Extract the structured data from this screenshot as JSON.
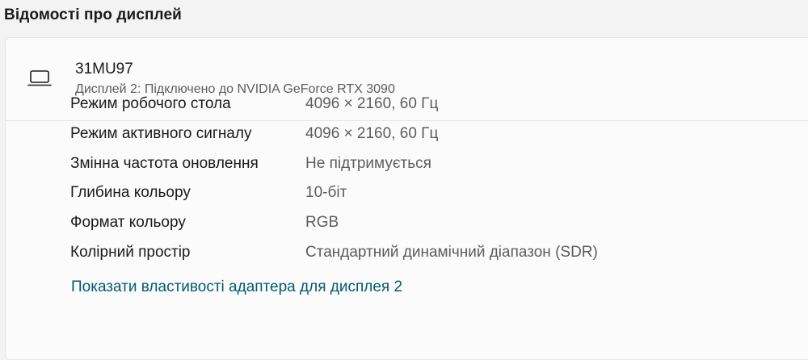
{
  "page": {
    "title": "Відомості про дисплей"
  },
  "display": {
    "name": "31MU97",
    "subtitle": "Дисплей 2: Підключено до NVIDIA GeForce RTX 3090",
    "icon": "laptop-icon"
  },
  "properties": [
    {
      "label": "Режим робочого стола",
      "value": "4096 × 2160, 60 Гц"
    },
    {
      "label": "Режим активного сигналу",
      "value": "4096 × 2160, 60 Гц"
    },
    {
      "label": "Змінна частота оновлення",
      "value": "Не підтримується"
    },
    {
      "label": "Глибина кольору",
      "value": "10-біт"
    },
    {
      "label": "Формат кольору",
      "value": "RGB"
    },
    {
      "label": "Колірний простір",
      "value": "Стандартний динамічний діапазон (SDR)"
    }
  ],
  "link": {
    "adapter_properties": "Показати властивості адаптера для дисплея 2"
  },
  "colors": {
    "link": "#005a70",
    "secondary_text": "#5d5d5d",
    "background": "#f3f3f3",
    "card": "#fbfbfb"
  }
}
